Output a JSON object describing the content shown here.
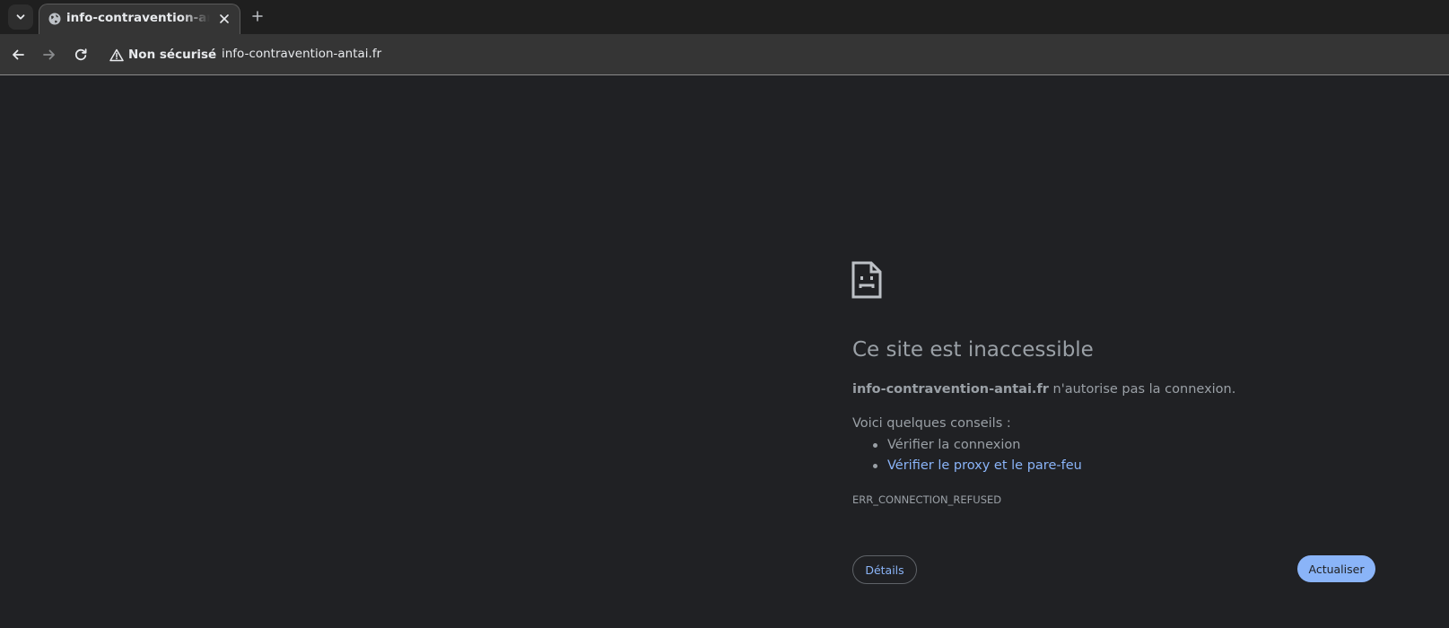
{
  "browser": {
    "tabs": [
      {
        "title": "info-contravention-antai.fr",
        "favicon": "globe-icon",
        "active": true
      }
    ],
    "toolbar": {
      "security_icon": "warning-triangle-icon",
      "security_label": "Non sécurisé",
      "url": "info-contravention-antai.fr"
    },
    "colors": {
      "tabstrip_bg": "#1f1f1f",
      "toolbar_bg": "#353535",
      "page_bg": "#202124",
      "text_muted": "#9aa0a6",
      "link": "#8ab4f8"
    }
  },
  "error_page": {
    "icon": "sad-document-icon",
    "title": "Ce site est inaccessible",
    "summary_host": "info-contravention-antai.fr",
    "summary_rest": " n'autorise pas la connexion.",
    "tips_heading": "Voici quelques conseils :",
    "tips": [
      {
        "label": "Vérifier la connexion",
        "is_link": false
      },
      {
        "label": "Vérifier le proxy et le pare-feu",
        "is_link": true
      }
    ],
    "error_code": "ERR_CONNECTION_REFUSED",
    "details_label": "Détails",
    "reload_label": "Actualiser"
  }
}
